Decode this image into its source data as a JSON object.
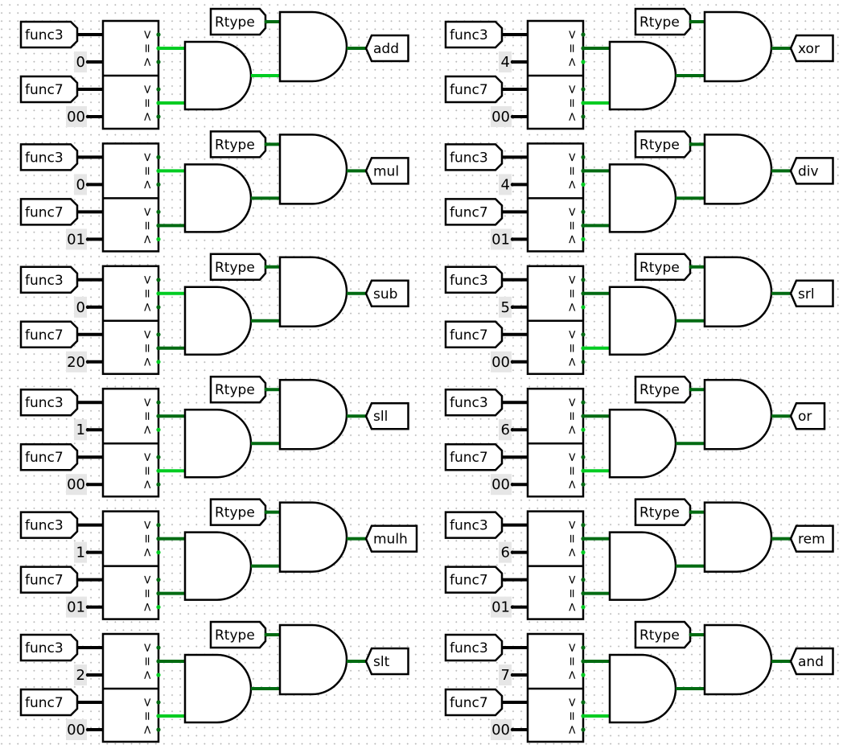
{
  "app": {
    "type": "logic-circuit-canvas"
  },
  "colors": {
    "wire_true": "#00cc22",
    "wire_false": "#006b12",
    "wire_bus": "#000000",
    "component_stroke": "#000000",
    "constant_bg": "#e6e6e6",
    "grid_dot": "#b8b8b8"
  },
  "labels": {
    "func3": "func3",
    "func7": "func7",
    "rtype": "Rtype",
    "gt": ">",
    "eq": "=",
    "lt": "<"
  },
  "blocks": [
    {
      "output": "add",
      "func3_const": "0",
      "func7_const": "00",
      "f3_gt": 0,
      "f3_eq": 1,
      "f3_lt": 0,
      "f7_gt": 0,
      "f7_eq": 1,
      "f7_lt": 0,
      "and1": 1,
      "rtype": 0,
      "out": 0
    },
    {
      "output": "mul",
      "func3_const": "0",
      "func7_const": "01",
      "f3_gt": 0,
      "f3_eq": 1,
      "f3_lt": 0,
      "f7_gt": 0,
      "f7_eq": 0,
      "f7_lt": 1,
      "and1": 0,
      "rtype": 0,
      "out": 0
    },
    {
      "output": "sub",
      "func3_const": "0",
      "func7_const": "20",
      "f3_gt": 0,
      "f3_eq": 1,
      "f3_lt": 0,
      "f7_gt": 0,
      "f7_eq": 0,
      "f7_lt": 1,
      "and1": 0,
      "rtype": 0,
      "out": 0
    },
    {
      "output": "sll",
      "func3_const": "1",
      "func7_const": "00",
      "f3_gt": 0,
      "f3_eq": 0,
      "f3_lt": 1,
      "f7_gt": 0,
      "f7_eq": 1,
      "f7_lt": 0,
      "and1": 0,
      "rtype": 0,
      "out": 0
    },
    {
      "output": "mulh",
      "func3_const": "1",
      "func7_const": "01",
      "f3_gt": 0,
      "f3_eq": 0,
      "f3_lt": 1,
      "f7_gt": 0,
      "f7_eq": 0,
      "f7_lt": 1,
      "and1": 0,
      "rtype": 0,
      "out": 0
    },
    {
      "output": "slt",
      "func3_const": "2",
      "func7_const": "00",
      "f3_gt": 0,
      "f3_eq": 0,
      "f3_lt": 1,
      "f7_gt": 0,
      "f7_eq": 1,
      "f7_lt": 0,
      "and1": 0,
      "rtype": 0,
      "out": 0
    },
    {
      "output": "xor",
      "func3_const": "4",
      "func7_const": "00",
      "f3_gt": 0,
      "f3_eq": 0,
      "f3_lt": 1,
      "f7_gt": 0,
      "f7_eq": 1,
      "f7_lt": 0,
      "and1": 0,
      "rtype": 0,
      "out": 0
    },
    {
      "output": "div",
      "func3_const": "4",
      "func7_const": "01",
      "f3_gt": 0,
      "f3_eq": 0,
      "f3_lt": 1,
      "f7_gt": 0,
      "f7_eq": 0,
      "f7_lt": 1,
      "and1": 0,
      "rtype": 0,
      "out": 0
    },
    {
      "output": "srl",
      "func3_const": "5",
      "func7_const": "00",
      "f3_gt": 0,
      "f3_eq": 0,
      "f3_lt": 1,
      "f7_gt": 0,
      "f7_eq": 1,
      "f7_lt": 0,
      "and1": 0,
      "rtype": 0,
      "out": 0
    },
    {
      "output": "or",
      "func3_const": "6",
      "func7_const": "00",
      "f3_gt": 0,
      "f3_eq": 0,
      "f3_lt": 1,
      "f7_gt": 0,
      "f7_eq": 1,
      "f7_lt": 0,
      "and1": 0,
      "rtype": 0,
      "out": 0
    },
    {
      "output": "rem",
      "func3_const": "6",
      "func7_const": "01",
      "f3_gt": 0,
      "f3_eq": 0,
      "f3_lt": 1,
      "f7_gt": 0,
      "f7_eq": 0,
      "f7_lt": 1,
      "and1": 0,
      "rtype": 0,
      "out": 0
    },
    {
      "output": "and",
      "func3_const": "7",
      "func7_const": "00",
      "f3_gt": 0,
      "f3_eq": 0,
      "f3_lt": 1,
      "f7_gt": 0,
      "f7_eq": 1,
      "f7_lt": 0,
      "and1": 0,
      "rtype": 0,
      "out": 0
    }
  ]
}
